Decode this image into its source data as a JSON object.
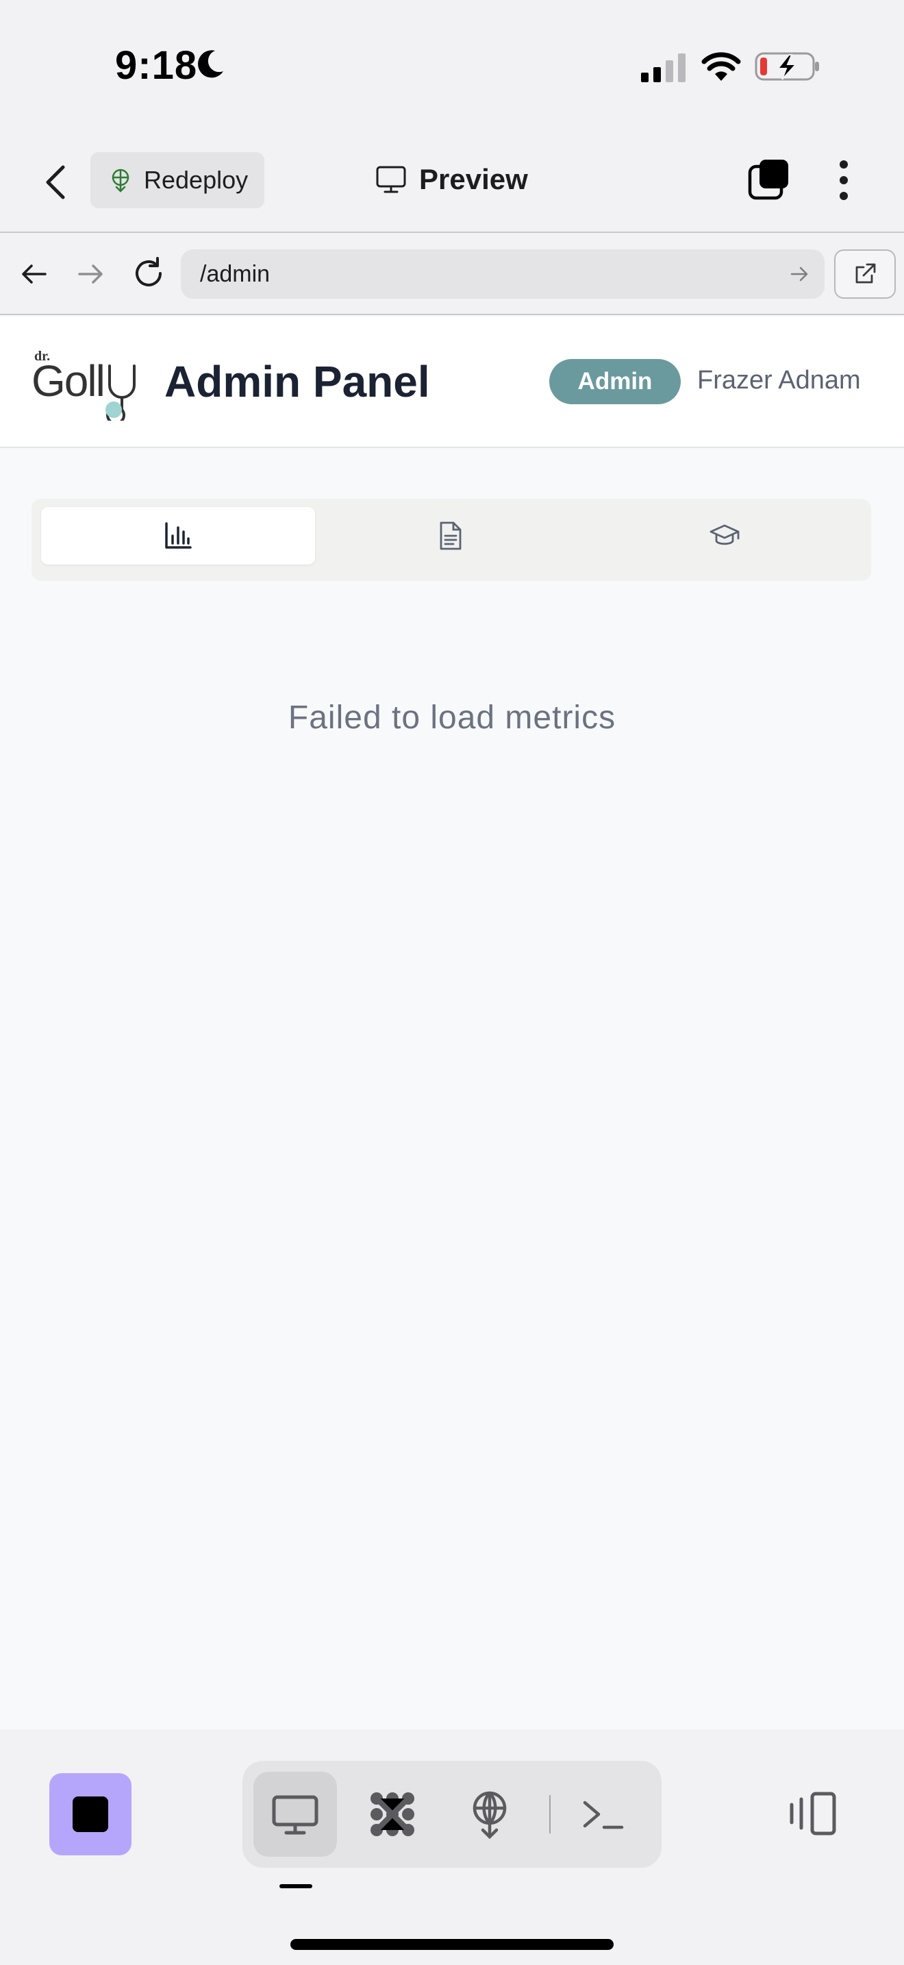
{
  "status_bar": {
    "time": "9:18"
  },
  "app_header": {
    "redeploy_label": "Redeploy",
    "title": "Preview"
  },
  "browser": {
    "url": "/admin"
  },
  "site": {
    "logo_text": "dr. Golly",
    "title": "Admin Panel",
    "role_badge": "Admin",
    "user_name": "Frazer Adnam",
    "accent_color": "#6b9a9e"
  },
  "admin_tabs": [
    {
      "icon": "bar-chart-icon",
      "active": true
    },
    {
      "icon": "document-icon",
      "active": false
    },
    {
      "icon": "graduation-cap-icon",
      "active": false
    }
  ],
  "main": {
    "message": "Failed to load metrics"
  },
  "bottom_toolbar": {
    "stop_color": "#b6a6fb",
    "segments": [
      "desktop-icon",
      "agents-icon",
      "deploy-icon",
      "terminal-icon"
    ],
    "active_segment": "desktop-icon"
  }
}
